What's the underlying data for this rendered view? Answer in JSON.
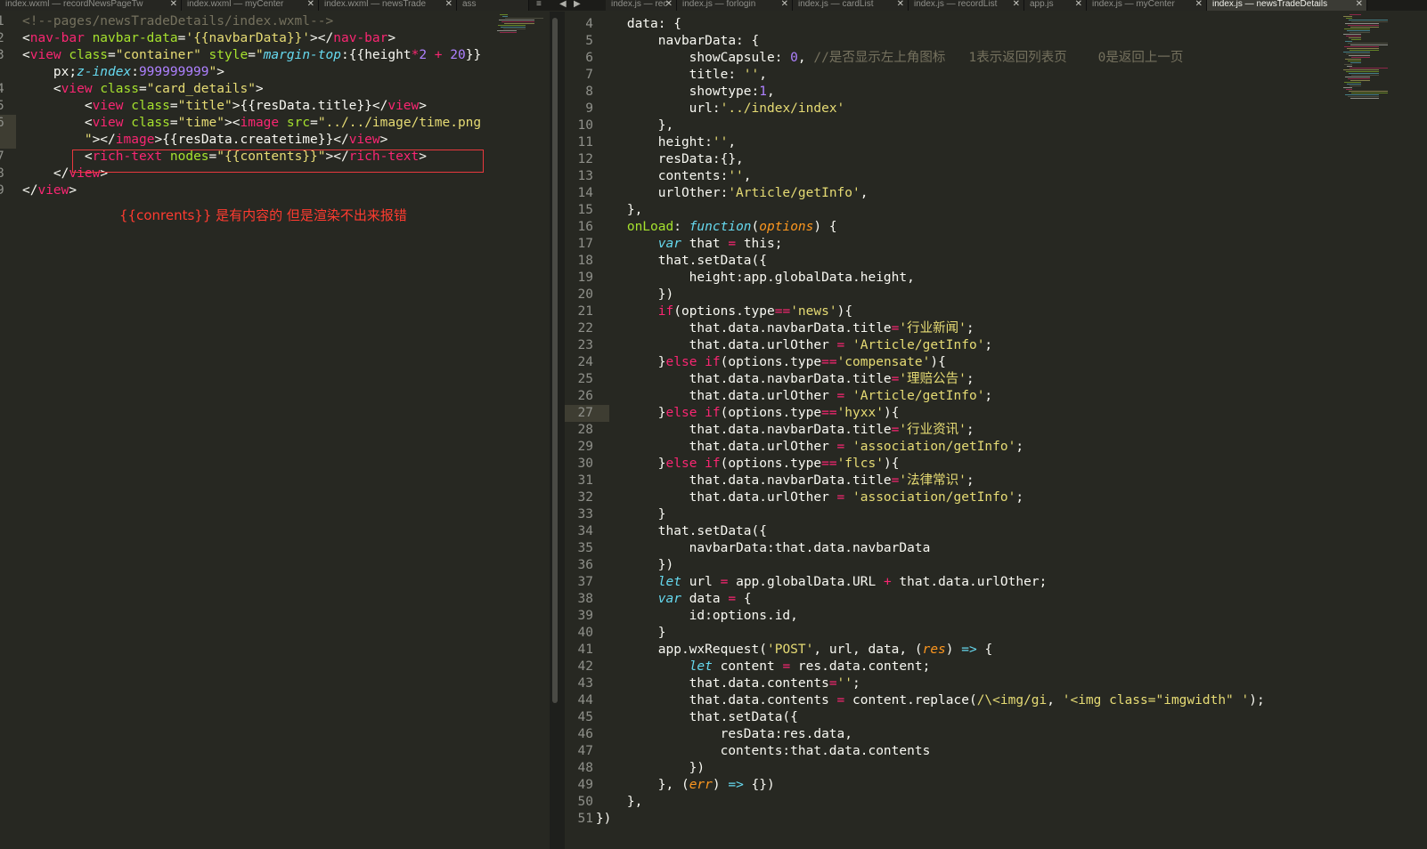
{
  "tabs_left": [
    {
      "title": "index.wxml — recordNewsPageTw",
      "active": false
    },
    {
      "title": "index.wxml — myCenter",
      "active": false
    },
    {
      "title": "index.wxml — newsTrade",
      "active": false
    },
    {
      "title": "ass",
      "active": false
    }
  ],
  "tabs_right": [
    {
      "title": "index.js — rec",
      "active": false
    },
    {
      "title": "index.js — forlogin",
      "active": false
    },
    {
      "title": "index.js — cardList",
      "active": false
    },
    {
      "title": "index.js — recordList",
      "active": false
    },
    {
      "title": "app.js",
      "active": false
    },
    {
      "title": "index.js — myCenter",
      "active": false
    },
    {
      "title": "index.js — newsTradeDetails",
      "active": true
    }
  ],
  "split_controls": {
    "menu": "≡",
    "prev": "◀",
    "next": "▶"
  },
  "tab_close": "✕",
  "left_gutter": [
    "1",
    "2",
    "3",
    "",
    "4",
    "5",
    "6",
    "",
    "7",
    "8",
    "9"
  ],
  "right_gutter": [
    "4",
    "5",
    "6",
    "7",
    "8",
    "9",
    "10",
    "11",
    "12",
    "13",
    "14",
    "15",
    "16",
    "17",
    "18",
    "19",
    "20",
    "21",
    "22",
    "23",
    "24",
    "25",
    "26",
    "27",
    "28",
    "29",
    "30",
    "31",
    "32",
    "33",
    "34",
    "35",
    "36",
    "37",
    "38",
    "39",
    "40",
    "41",
    "42",
    "43",
    "44",
    "45",
    "46",
    "47",
    "48",
    "49",
    "50",
    "51"
  ],
  "left_code": [
    [
      [
        "c",
        "<!--pages/newsTradeDetails/index.wxml-->"
      ]
    ],
    [
      [
        "w",
        "<"
      ],
      [
        "k",
        "nav-bar"
      ],
      [
        "w",
        " "
      ],
      [
        "a",
        "navbar-data"
      ],
      [
        "w",
        "="
      ],
      [
        "s",
        "'{{navbarData}}'"
      ],
      [
        "w",
        "></"
      ],
      [
        "k",
        "nav-bar"
      ],
      [
        "w",
        ">"
      ]
    ],
    [
      [
        "w",
        "<"
      ],
      [
        "k",
        "view"
      ],
      [
        "w",
        " "
      ],
      [
        "a",
        "class"
      ],
      [
        "w",
        "="
      ],
      [
        "s",
        "\"container\""
      ],
      [
        "w",
        " "
      ],
      [
        "a",
        "style"
      ],
      [
        "w",
        "="
      ],
      [
        "s",
        "\""
      ],
      [
        "i",
        "margin-top"
      ],
      [
        "w",
        ":{{"
      ],
      [
        "w",
        "height"
      ],
      [
        "k",
        "*"
      ],
      [
        "n",
        "2"
      ],
      [
        "w",
        " "
      ],
      [
        "k",
        "+"
      ],
      [
        "w",
        " "
      ],
      [
        "n",
        "20"
      ],
      [
        "w",
        "}}"
      ]
    ],
    [
      [
        "w",
        "    px;"
      ],
      [
        "i",
        "z-index"
      ],
      [
        "w",
        ":"
      ],
      [
        "n",
        "999999999"
      ],
      [
        "s",
        "\""
      ],
      [
        "w",
        ">"
      ]
    ],
    [
      [
        "w",
        "    <"
      ],
      [
        "k",
        "view"
      ],
      [
        "w",
        " "
      ],
      [
        "a",
        "class"
      ],
      [
        "w",
        "="
      ],
      [
        "s",
        "\"card_details\""
      ],
      [
        "w",
        ">"
      ]
    ],
    [
      [
        "w",
        "        <"
      ],
      [
        "k",
        "view"
      ],
      [
        "w",
        " "
      ],
      [
        "a",
        "class"
      ],
      [
        "w",
        "="
      ],
      [
        "s",
        "\"title\""
      ],
      [
        "w",
        ">{{resData.title}}</"
      ],
      [
        "k",
        "view"
      ],
      [
        "w",
        ">"
      ]
    ],
    [
      [
        "w",
        "        <"
      ],
      [
        "k",
        "view"
      ],
      [
        "w",
        " "
      ],
      [
        "a",
        "class"
      ],
      [
        "w",
        "="
      ],
      [
        "s",
        "\"time\""
      ],
      [
        "w",
        "><"
      ],
      [
        "k",
        "image"
      ],
      [
        "w",
        " "
      ],
      [
        "a",
        "src"
      ],
      [
        "w",
        "="
      ],
      [
        "s",
        "\"../../image/time.png"
      ]
    ],
    [
      [
        "s",
        "        \""
      ],
      [
        "w",
        "></"
      ],
      [
        "k",
        "image"
      ],
      [
        "w",
        ">{{resData.createtime}}</"
      ],
      [
        "k",
        "view"
      ],
      [
        "w",
        ">"
      ]
    ],
    [
      [
        "w",
        "        <"
      ],
      [
        "k",
        "rich-text"
      ],
      [
        "w",
        " "
      ],
      [
        "a",
        "nodes"
      ],
      [
        "w",
        "="
      ],
      [
        "s",
        "\"{{contents}}\""
      ],
      [
        "w",
        "></"
      ],
      [
        "k",
        "rich-text"
      ],
      [
        "w",
        ">"
      ]
    ],
    [
      [
        "w",
        "    </"
      ],
      [
        "k",
        "view"
      ],
      [
        "w",
        ">"
      ]
    ],
    [
      [
        "w",
        "</"
      ],
      [
        "k",
        "view"
      ],
      [
        "w",
        ">"
      ]
    ]
  ],
  "annotation": "{{conrents}} 是有内容的 但是渲染不出来报错",
  "right_code": [
    [
      [
        "w",
        "        data: {"
      ]
    ],
    [
      [
        "w",
        "            navbarData: {"
      ]
    ],
    [
      [
        "w",
        "                showCapsule: "
      ],
      [
        "n",
        "0"
      ],
      [
        "w",
        ", "
      ],
      [
        "c",
        "//是否显示左上角图标   1表示返回列表页    0是返回上一页"
      ]
    ],
    [
      [
        "w",
        "                title: "
      ],
      [
        "s",
        "''"
      ],
      [
        "w",
        ","
      ]
    ],
    [
      [
        "w",
        "                showtype:"
      ],
      [
        "n",
        "1"
      ],
      [
        "w",
        ","
      ]
    ],
    [
      [
        "w",
        "                url:"
      ],
      [
        "s",
        "'../index/index'"
      ]
    ],
    [
      [
        "w",
        "            },"
      ]
    ],
    [
      [
        "w",
        "            height:"
      ],
      [
        "s",
        "''"
      ],
      [
        "w",
        ","
      ]
    ],
    [
      [
        "w",
        "            resData:{},"
      ]
    ],
    [
      [
        "w",
        "            contents:"
      ],
      [
        "s",
        "''"
      ],
      [
        "w",
        ","
      ]
    ],
    [
      [
        "w",
        "            urlOther:"
      ],
      [
        "s",
        "'Article/getInfo'"
      ],
      [
        "w",
        ","
      ]
    ],
    [
      [
        "w",
        "        },"
      ]
    ],
    [
      [
        "w",
        "        "
      ],
      [
        "f",
        "onLoad"
      ],
      [
        "w",
        ": "
      ],
      [
        "i",
        "function"
      ],
      [
        "w",
        "("
      ],
      [
        "o",
        "options"
      ],
      [
        "w",
        ") {"
      ]
    ],
    [
      [
        "w",
        "            "
      ],
      [
        "i",
        "var"
      ],
      [
        "w",
        " that "
      ],
      [
        "k",
        "="
      ],
      [
        "w",
        " this;"
      ]
    ],
    [
      [
        "w",
        "            that.setData({"
      ]
    ],
    [
      [
        "w",
        "                height:app.globalData.height,"
      ]
    ],
    [
      [
        "w",
        "            })"
      ]
    ],
    [
      [
        "w",
        "            "
      ],
      [
        "k",
        "if"
      ],
      [
        "w",
        "(options.type"
      ],
      [
        "k",
        "=="
      ],
      [
        "s",
        "'news'"
      ],
      [
        "w",
        "){"
      ]
    ],
    [
      [
        "w",
        "                that.data.navbarData.title"
      ],
      [
        "k",
        "="
      ],
      [
        "s",
        "'行业新闻'"
      ],
      [
        "w",
        ";"
      ]
    ],
    [
      [
        "w",
        "                that.data.urlOther "
      ],
      [
        "k",
        "="
      ],
      [
        "w",
        " "
      ],
      [
        "s",
        "'Article/getInfo'"
      ],
      [
        "w",
        ";"
      ]
    ],
    [
      [
        "w",
        "            }"
      ],
      [
        "k",
        "else if"
      ],
      [
        "w",
        "(options.type"
      ],
      [
        "k",
        "=="
      ],
      [
        "s",
        "'compensate'"
      ],
      [
        "w",
        "){"
      ]
    ],
    [
      [
        "w",
        "                that.data.navbarData.title"
      ],
      [
        "k",
        "="
      ],
      [
        "s",
        "'理赔公告'"
      ],
      [
        "w",
        ";"
      ]
    ],
    [
      [
        "w",
        "                that.data.urlOther "
      ],
      [
        "k",
        "="
      ],
      [
        "w",
        " "
      ],
      [
        "s",
        "'Article/getInfo'"
      ],
      [
        "w",
        ";"
      ]
    ],
    [
      [
        "w",
        "            }"
      ],
      [
        "k",
        "else if"
      ],
      [
        "w",
        "(options.type"
      ],
      [
        "k",
        "=="
      ],
      [
        "s",
        "'hyxx'"
      ],
      [
        "w",
        "){"
      ]
    ],
    [
      [
        "w",
        "                that.data.navbarData.title"
      ],
      [
        "k",
        "="
      ],
      [
        "s",
        "'行业资讯'"
      ],
      [
        "w",
        ";"
      ]
    ],
    [
      [
        "w",
        "                that.data.urlOther "
      ],
      [
        "k",
        "="
      ],
      [
        "w",
        " "
      ],
      [
        "s",
        "'association/getInfo'"
      ],
      [
        "w",
        ";"
      ]
    ],
    [
      [
        "w",
        "            }"
      ],
      [
        "k",
        "else if"
      ],
      [
        "w",
        "(options.type"
      ],
      [
        "k",
        "=="
      ],
      [
        "s",
        "'flcs'"
      ],
      [
        "w",
        "){"
      ]
    ],
    [
      [
        "w",
        "                that.data.navbarData.title"
      ],
      [
        "k",
        "="
      ],
      [
        "s",
        "'法律常识'"
      ],
      [
        "w",
        ";"
      ]
    ],
    [
      [
        "w",
        "                that.data.urlOther "
      ],
      [
        "k",
        "="
      ],
      [
        "w",
        " "
      ],
      [
        "s",
        "'association/getInfo'"
      ],
      [
        "w",
        ";"
      ]
    ],
    [
      [
        "w",
        "            }"
      ]
    ],
    [
      [
        "w",
        "            that.setData({"
      ]
    ],
    [
      [
        "w",
        "                navbarData:that.data.navbarData"
      ]
    ],
    [
      [
        "w",
        "            })"
      ]
    ],
    [
      [
        "w",
        "            "
      ],
      [
        "i",
        "let"
      ],
      [
        "w",
        " url "
      ],
      [
        "k",
        "="
      ],
      [
        "w",
        " app.globalData.URL "
      ],
      [
        "k",
        "+"
      ],
      [
        "w",
        " that.data.urlOther;"
      ]
    ],
    [
      [
        "w",
        "            "
      ],
      [
        "i",
        "var"
      ],
      [
        "w",
        " data "
      ],
      [
        "k",
        "="
      ],
      [
        "w",
        " {"
      ]
    ],
    [
      [
        "w",
        "                id:options.id,"
      ]
    ],
    [
      [
        "w",
        "            }"
      ]
    ],
    [
      [
        "w",
        "            app.wxRequest("
      ],
      [
        "s",
        "'POST'"
      ],
      [
        "w",
        ", url, data, ("
      ],
      [
        "o",
        "res"
      ],
      [
        "w",
        ") "
      ],
      [
        "i",
        "=>"
      ],
      [
        "w",
        " {"
      ]
    ],
    [
      [
        "w",
        "                "
      ],
      [
        "i",
        "let"
      ],
      [
        "w",
        " content "
      ],
      [
        "k",
        "="
      ],
      [
        "w",
        " res.data.content;"
      ]
    ],
    [
      [
        "w",
        "                that.data.contents"
      ],
      [
        "k",
        "="
      ],
      [
        "s",
        "''"
      ],
      [
        "w",
        ";"
      ]
    ],
    [
      [
        "w",
        "                that.data.contents "
      ],
      [
        "k",
        "="
      ],
      [
        "w",
        " content.replace("
      ],
      [
        "s",
        "/\\<img/gi"
      ],
      [
        "w",
        ", "
      ],
      [
        "s",
        "'<img class=\"imgwidth\" '"
      ],
      [
        "w",
        ");"
      ]
    ],
    [
      [
        "w",
        "                that.setData({"
      ]
    ],
    [
      [
        "w",
        "                    resData:res.data,"
      ]
    ],
    [
      [
        "w",
        "                    contents:that.data.contents"
      ]
    ],
    [
      [
        "w",
        "                })"
      ]
    ],
    [
      [
        "w",
        "            }, ("
      ],
      [
        "o",
        "err"
      ],
      [
        "w",
        ") "
      ],
      [
        "i",
        "=>"
      ],
      [
        "w",
        " {})"
      ]
    ],
    [
      [
        "w",
        "        },"
      ]
    ],
    [
      [
        "w",
        "    })"
      ]
    ]
  ],
  "colors": {
    "background": "#272822",
    "keyword": "#f92672",
    "string": "#e6db74",
    "attribute": "#a6e22e",
    "comment": "#75715e",
    "number": "#ae81ff",
    "storage": "#66d9ef",
    "param": "#fd971f",
    "annotation": "#ff3b30"
  }
}
